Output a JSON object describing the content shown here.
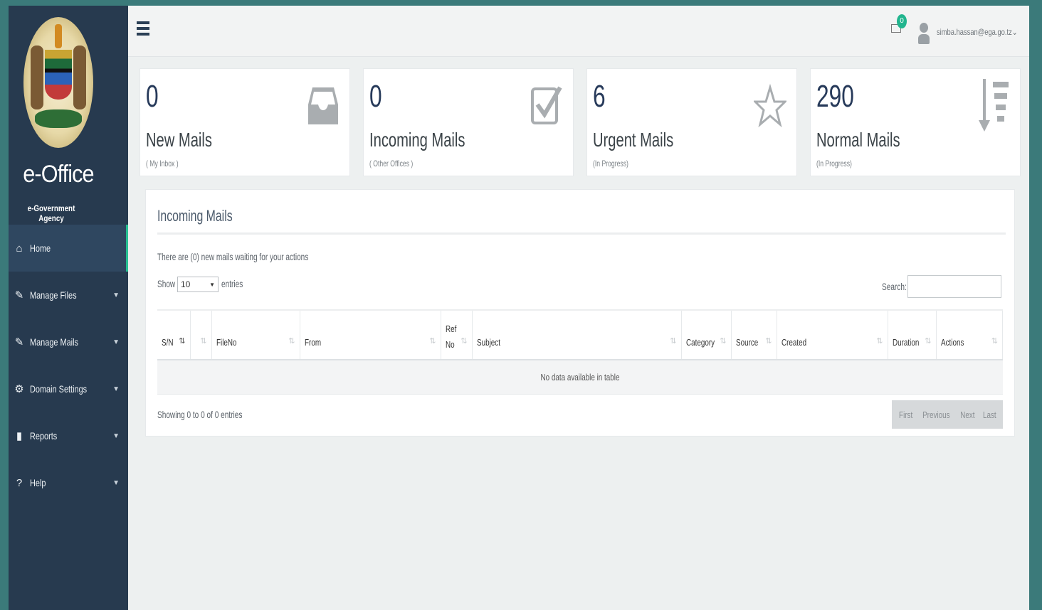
{
  "app": {
    "title": "e-Office",
    "subtitle": "e-Government Agency"
  },
  "sidebar": {
    "items": [
      {
        "label": "Home",
        "icon": "home-icon"
      },
      {
        "label": "Manage Files",
        "icon": "edit-icon"
      },
      {
        "label": "Manage Mails",
        "icon": "edit-icon"
      },
      {
        "label": "Domain Settings",
        "icon": "gear-icon"
      },
      {
        "label": "Reports",
        "icon": "bar-chart-icon"
      },
      {
        "label": "Help",
        "icon": "question-icon"
      }
    ]
  },
  "header": {
    "mail_badge": "0",
    "user_email": "simba.hassan@ega.go.tz"
  },
  "stats": [
    {
      "value": "0",
      "label": "New Mails",
      "sub": "( My Inbox )",
      "icon": "inbox-icon"
    },
    {
      "value": "0",
      "label": "Incoming Mails",
      "sub": "( Other Offices )",
      "icon": "checkbox-icon"
    },
    {
      "value": "6",
      "label": "Urgent Mails",
      "sub": "(In Progress)",
      "icon": "star-icon"
    },
    {
      "value": "290",
      "label": "Normal Mails",
      "sub": "(In Progress)",
      "icon": "sort-icon"
    }
  ],
  "panel": {
    "title": "Incoming Mails",
    "message": "There are (0) new mails waiting for your actions",
    "show_label": "Show",
    "entries_value": "10",
    "entries_label": "entries",
    "search_label": "Search:",
    "columns": [
      "S/N",
      "",
      "FileNo",
      "From",
      "Ref No",
      "Subject",
      "Category",
      "Source",
      "Created",
      "Duration",
      "Actions"
    ],
    "empty_text": "No data available in table",
    "info": "Showing 0 to 0 of 0 entries",
    "pager": [
      "First",
      "Previous",
      "Next",
      "Last"
    ]
  },
  "colors": {
    "sidebar_bg": "#273a4f",
    "accent": "#27c092",
    "number": "#273a5a"
  }
}
